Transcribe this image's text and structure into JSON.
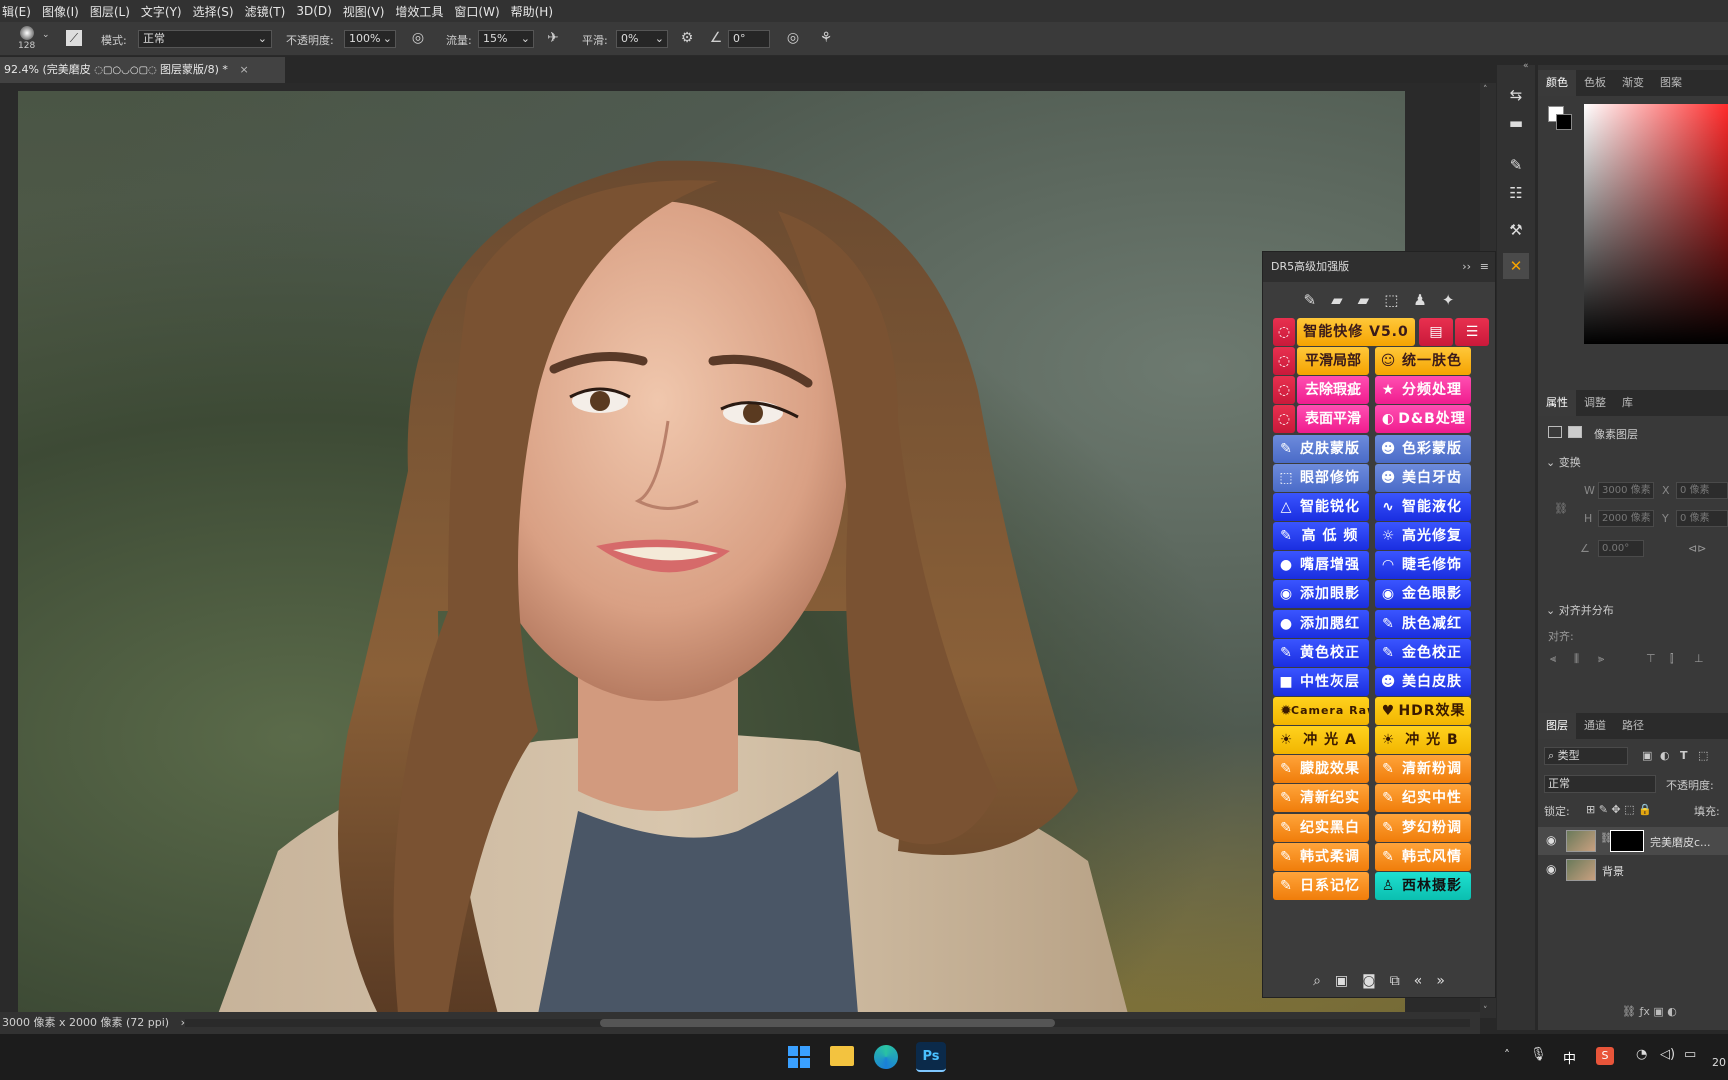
{
  "menu": [
    "辑(E)",
    "图像(I)",
    "图层(L)",
    "文字(Y)",
    "选择(S)",
    "滤镜(T)",
    "3D(D)",
    "视图(V)",
    "增效工具",
    "窗口(W)",
    "帮助(H)"
  ],
  "options": {
    "brush_size": "128",
    "mode_label": "模式:",
    "mode_value": "正常",
    "opacity_label": "不透明度:",
    "opacity_value": "100%",
    "flow_label": "流量:",
    "flow_value": "15%",
    "smooth_label": "平滑:",
    "smooth_value": "0%",
    "angle_value": "0°"
  },
  "document_tab": {
    "title": "92.4% (完美磨皮",
    "suffix": "图层蒙版/8) *",
    "close": "×"
  },
  "status": {
    "text": "3000 像素 x 2000 像素 (72 ppi)",
    "arrow": "›"
  },
  "dr5": {
    "title": "DR5高级加强版",
    "collapse": "››",
    "rows": [
      [
        {
          "label": "智能快修 V5.0",
          "color": "c-orange",
          "icon": "◌",
          "wide": true
        }
      ],
      [
        {
          "label": "平滑局部",
          "color": "c-orange",
          "icon": "◌"
        },
        {
          "label": "统一肤色",
          "color": "c-orange",
          "icon": "☺"
        }
      ],
      [
        {
          "label": "去除瑕疵",
          "color": "c-pink",
          "icon": "◌"
        },
        {
          "label": "分频处理",
          "color": "c-pink",
          "icon": "★"
        }
      ],
      [
        {
          "label": "表面平滑",
          "color": "c-pink",
          "icon": "◌"
        },
        {
          "label": "D&B处理",
          "color": "c-pink",
          "icon": "◐"
        }
      ],
      [
        {
          "label": "皮肤蒙版",
          "color": "c-steel",
          "icon": "✎"
        },
        {
          "label": "色彩蒙版",
          "color": "c-steel",
          "icon": "☻"
        }
      ],
      [
        {
          "label": "眼部修饰",
          "color": "c-steel",
          "icon": "⬚"
        },
        {
          "label": "美白牙齿",
          "color": "c-steel",
          "icon": "☻"
        }
      ],
      [
        {
          "label": "智能锐化",
          "color": "c-blue",
          "icon": "△"
        },
        {
          "label": "智能液化",
          "color": "c-blue",
          "icon": "∿"
        }
      ],
      [
        {
          "label": "高 低 频",
          "color": "c-blue",
          "icon": "✎"
        },
        {
          "label": "高光修复",
          "color": "c-blue",
          "icon": "☼"
        }
      ],
      [
        {
          "label": "嘴唇增强",
          "color": "c-blue",
          "icon": "●"
        },
        {
          "label": "睫毛修饰",
          "color": "c-blue",
          "icon": "◠"
        }
      ],
      [
        {
          "label": "添加眼影",
          "color": "c-blue",
          "icon": "◉"
        },
        {
          "label": "金色眼影",
          "color": "c-blue",
          "icon": "◉"
        }
      ],
      [
        {
          "label": "添加腮红",
          "color": "c-blue",
          "icon": "●"
        },
        {
          "label": "肤色减红",
          "color": "c-blue",
          "icon": "✎"
        }
      ],
      [
        {
          "label": "黄色校正",
          "color": "c-blue",
          "icon": "✎"
        },
        {
          "label": "金色校正",
          "color": "c-blue",
          "icon": "✎"
        }
      ],
      [
        {
          "label": "中性灰层",
          "color": "c-blue",
          "icon": "■"
        },
        {
          "label": "美白皮肤",
          "color": "c-blue",
          "icon": "☻"
        }
      ],
      [
        {
          "label": "Camera Raw",
          "color": "c-yellow",
          "icon": "✹"
        },
        {
          "label": "HDR效果",
          "color": "c-yellow",
          "icon": "♥"
        }
      ],
      [
        {
          "label": "冲 光 A",
          "color": "c-yellow",
          "icon": "☀"
        },
        {
          "label": "冲 光 B",
          "color": "c-yellow",
          "icon": "☀"
        }
      ],
      [
        {
          "label": "朦胧效果",
          "color": "c-amber",
          "icon": "✎"
        },
        {
          "label": "清新粉调",
          "color": "c-amber",
          "icon": "✎"
        }
      ],
      [
        {
          "label": "清新纪实",
          "color": "c-amber",
          "icon": "✎"
        },
        {
          "label": "纪实中性",
          "color": "c-amber",
          "icon": "✎"
        }
      ],
      [
        {
          "label": "纪实黑白",
          "color": "c-amber",
          "icon": "✎"
        },
        {
          "label": "梦幻粉调",
          "color": "c-amber",
          "icon": "✎"
        }
      ],
      [
        {
          "label": "韩式柔调",
          "color": "c-amber",
          "icon": "✎"
        },
        {
          "label": "韩式风情",
          "color": "c-amber",
          "icon": "✎"
        }
      ],
      [
        {
          "label": "日系记忆",
          "color": "c-amber",
          "icon": "✎"
        },
        {
          "label": "西林摄影",
          "color": "c-cyan",
          "icon": "♙"
        }
      ]
    ]
  },
  "right_panel": {
    "color_tabs": [
      "颜色",
      "色板",
      "渐变",
      "图案"
    ],
    "prop_tabs": [
      "属性",
      "调整",
      "库"
    ],
    "pixel_layer": "像素图层",
    "transform": "变换",
    "w_label": "W",
    "w_value": "3000 像素",
    "h_label": "H",
    "h_value": "2000 像素",
    "x_label": "X",
    "x_value": "0 像素",
    "y_label": "Y",
    "y_value": "0 像素",
    "angle": "0.00°",
    "align_section": "对齐并分布",
    "align_label": "对齐:",
    "layer_tabs": [
      "图层",
      "通道",
      "路径"
    ],
    "kind_filter": "类型",
    "blend_mode": "正常",
    "opacity_label": "不透明度:",
    "lock_label": "锁定:",
    "fill_label": "填充:",
    "layers": [
      {
        "name": "完美磨皮c...",
        "has_mask": true
      },
      {
        "name": "背景",
        "has_mask": false
      }
    ]
  },
  "taskbar": {
    "ime": "中",
    "ps_label": "Ps",
    "clock": "20"
  },
  "colors": {
    "menubar": "#323232",
    "panel": "#3c3c3c",
    "accent_orange": "#f5a300"
  }
}
